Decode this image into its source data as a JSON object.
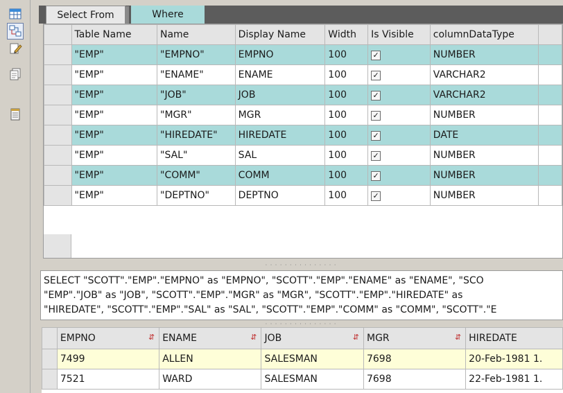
{
  "toolbar": {
    "items": [
      {
        "icon": "table-icon"
      },
      {
        "icon": "query-builder-icon"
      },
      {
        "icon": "edit-icon"
      },
      {
        "icon": "documents-icon"
      },
      {
        "icon": "notepad-icon"
      }
    ]
  },
  "tabs": [
    {
      "label": "Select From",
      "active": true
    },
    {
      "label": "Where",
      "active": false
    }
  ],
  "columns_grid": {
    "headers": [
      "Table Name",
      "Name",
      "Display Name",
      "Width",
      "Is Visible",
      "columnDataType"
    ],
    "rows": [
      {
        "table_name": "\"EMP\"",
        "name": "\"EMPNO\"",
        "display_name": "EMPNO",
        "width": "100",
        "is_visible": true,
        "data_type": "NUMBER"
      },
      {
        "table_name": "\"EMP\"",
        "name": "\"ENAME\"",
        "display_name": "ENAME",
        "width": "100",
        "is_visible": true,
        "data_type": "VARCHAR2"
      },
      {
        "table_name": "\"EMP\"",
        "name": "\"JOB\"",
        "display_name": "JOB",
        "width": "100",
        "is_visible": true,
        "data_type": "VARCHAR2"
      },
      {
        "table_name": "\"EMP\"",
        "name": "\"MGR\"",
        "display_name": "MGR",
        "width": "100",
        "is_visible": true,
        "data_type": "NUMBER"
      },
      {
        "table_name": "\"EMP\"",
        "name": "\"HIREDATE\"",
        "display_name": "HIREDATE",
        "width": "100",
        "is_visible": true,
        "data_type": "DATE"
      },
      {
        "table_name": "\"EMP\"",
        "name": "\"SAL\"",
        "display_name": "SAL",
        "width": "100",
        "is_visible": true,
        "data_type": "NUMBER"
      },
      {
        "table_name": "\"EMP\"",
        "name": "\"COMM\"",
        "display_name": "COMM",
        "width": "100",
        "is_visible": true,
        "data_type": "NUMBER"
      },
      {
        "table_name": "\"EMP\"",
        "name": "\"DEPTNO\"",
        "display_name": "DEPTNO",
        "width": "100",
        "is_visible": true,
        "data_type": "NUMBER"
      }
    ],
    "check_glyph": "✓"
  },
  "sql": {
    "lines": [
      "SELECT \"SCOTT\".\"EMP\".\"EMPNO\" as \"EMPNO\", \"SCOTT\".\"EMP\".\"ENAME\" as \"ENAME\", \"SCO",
      "\"EMP\".\"JOB\" as \"JOB\", \"SCOTT\".\"EMP\".\"MGR\" as \"MGR\", \"SCOTT\".\"EMP\".\"HIREDATE\" as",
      "\"HIREDATE\", \"SCOTT\".\"EMP\".\"SAL\" as \"SAL\", \"SCOTT\".\"EMP\".\"COMM\" as \"COMM\", \"SCOTT\".\"E"
    ]
  },
  "results_grid": {
    "headers": [
      "EMPNO",
      "ENAME",
      "JOB",
      "MGR",
      "HIREDATE"
    ],
    "sort_glyph": "⇵",
    "rows": [
      [
        "7499",
        "ALLEN",
        "SALESMAN",
        "7698",
        "20-Feb-1981 1."
      ],
      [
        "7521",
        "WARD",
        "SALESMAN",
        "7698",
        "22-Feb-1981 1."
      ]
    ]
  },
  "colors": {
    "row_alt": "#a9dada",
    "row_selected": "#fefed8",
    "tab_bar": "#5c5c5c",
    "sort_icon": "#c03030"
  }
}
